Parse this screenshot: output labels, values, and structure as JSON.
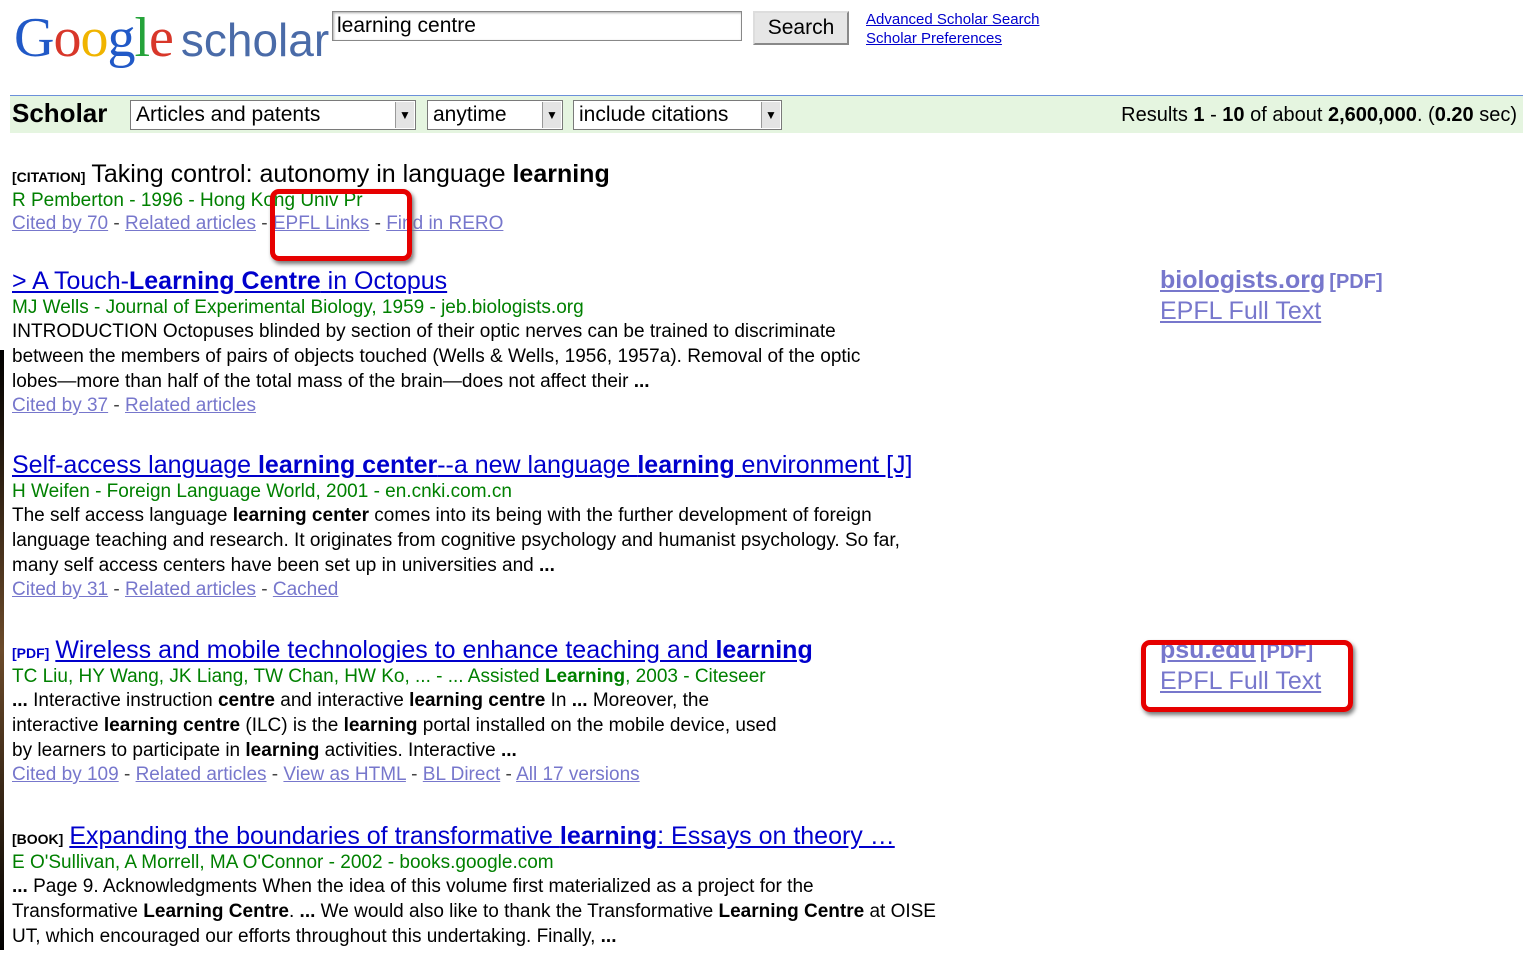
{
  "header": {
    "logo_google": "Google",
    "logo_scholar": "scholar",
    "search_value": "learning centre",
    "search_button": "Search",
    "advanced_link": "Advanced Scholar Search",
    "prefs_link": "Scholar Preferences"
  },
  "bar": {
    "title": "Scholar",
    "filter1": "Articles and patents",
    "filter2": "anytime",
    "filter3": "include citations",
    "results_prefix": "Results ",
    "results_from": "1",
    "results_dash": " - ",
    "results_to": "10",
    "results_of": " of about ",
    "results_total": "2,600,000",
    "results_dot": ". (",
    "results_time": "0.20",
    "results_end": " sec)"
  },
  "results": [
    {
      "tag": "[CITATION]",
      "title_parts": [
        "Taking control: autonomy in language ",
        "learning"
      ],
      "meta": "R Pemberton - 1996 - Hong Kong Univ Pr",
      "links": [
        "Cited by 70",
        "Related articles",
        "EPFL Links",
        "Find in RERO"
      ]
    },
    {
      "title_parts": [
        "> A Touch-",
        "Learning Centre",
        " in Octopus"
      ],
      "meta": "MJ Wells - Journal of Experimental Biology, 1959 - jeb.biologists.org",
      "snippet": [
        "INTRODUCTION Octopuses blinded by section of their optic nerves can be trained to discriminate between the members of pairs of objects touched (Wells & Wells, 1956, 1957a). Removal of the optic lobes—more than half of the total mass of the brain—does not affect their ",
        "..."
      ],
      "links": [
        "Cited by 37",
        "Related articles"
      ],
      "side_source": "biologists.org",
      "side_pdf": "[PDF]",
      "side_full": "EPFL Full Text"
    },
    {
      "title_parts": [
        "Self-access language ",
        "learning center",
        "--a new language ",
        "learning ",
        "environment [J]"
      ],
      "meta": "H Weifen - Foreign Language World, 2001 - en.cnki.com.cn",
      "snippet": [
        "The self access language ",
        "learning center",
        " comes into its being with the further development of foreign language teaching and research. It originates from cognitive psychology and humanist psychology. So far, many self access centers have been set up in universities and ",
        "..."
      ],
      "links": [
        "Cited by 31",
        "Related articles",
        "Cached"
      ]
    },
    {
      "tag": "[PDF]",
      "title_parts": [
        "Wireless and mobile technologies to enhance teaching and ",
        "learning"
      ],
      "meta_parts": [
        "TC Liu, HY Wang, JK Liang, TW Chan, HW Ko, ... - ... Assisted ",
        "Learning",
        ", 2003 - Citeseer"
      ],
      "snippet": [
        "...",
        " Interactive instruction ",
        "centre",
        " and interactive ",
        "learning centre",
        " In ",
        "...",
        " Moreover, the interactive ",
        "learning centre",
        " (ILC) is the ",
        "learning",
        " portal installed on the mobile device, used by learners to participate in ",
        "learning",
        " activities. Interactive ",
        "..."
      ],
      "links": [
        "Cited by 109",
        "Related articles",
        "View as HTML",
        "BL Direct",
        "All 17 versions"
      ],
      "side_source": "psu.edu",
      "side_pdf": "[PDF]",
      "side_full": "EPFL Full Text"
    },
    {
      "tag": "[BOOK]",
      "title_parts": [
        "Expanding the boundaries of transformative ",
        "learning",
        ": Essays on theory …"
      ],
      "meta": "E O'Sullivan, A Morrell, MA O'Connor - 2002 - books.google.com",
      "snippet": [
        "...",
        " Page 9. Acknowledgments When the idea of this volume first materialized as a project for the Transformative ",
        "Learning Centre",
        ". ",
        "...",
        " We would also like to thank the Transformative ",
        "Learning Centre",
        " at OISE UT, which encouraged our efforts throughout this undertaking. Finally, ",
        "..."
      ]
    }
  ],
  "colors": {
    "link": "#0000cc",
    "meta": "#008000",
    "bar_bg": "#e5f5e0",
    "highlight": "#e60000"
  }
}
